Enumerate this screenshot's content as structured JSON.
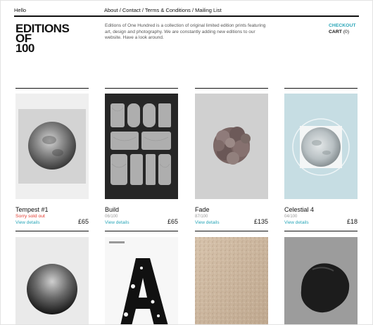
{
  "header": {
    "hello": "Hello",
    "nav": [
      "About",
      "Contact",
      "Terms & Conditions",
      "Mailing List"
    ],
    "separator": " / "
  },
  "logo": [
    "EDITIONS",
    "OF",
    "100"
  ],
  "intro": "Editions of One Hundred is a collection of original limited edition prints featuring art, design and photography. We are constantly adding new editions to our website. Have a look around.",
  "cart": {
    "checkout": "CHECKOUT",
    "label": "CART",
    "count": "(0)"
  },
  "colors": {
    "accent": "#2aa6b8",
    "soldout": "#e23a2e"
  },
  "products": [
    {
      "title": "Tempest #1",
      "status": "Sorry sold out",
      "view": "View details",
      "price": "£65",
      "image": "grey-moon-photo"
    },
    {
      "title": "Build",
      "status": "06/100",
      "view": "View details",
      "price": "£65",
      "image": "wood-type-poster"
    },
    {
      "title": "Fade",
      "status": "87/100",
      "view": "View details",
      "price": "£135",
      "image": "hydrangea-photo"
    },
    {
      "title": "Celestial 4",
      "status": "04/100",
      "view": "View details",
      "price": "£18",
      "image": "blue-moon-print"
    }
  ],
  "second_row": [
    {
      "image": "dark-sphere-photo"
    },
    {
      "image": "letter-a-poster"
    },
    {
      "image": "sand-texture"
    },
    {
      "image": "black-rock-photo"
    }
  ]
}
